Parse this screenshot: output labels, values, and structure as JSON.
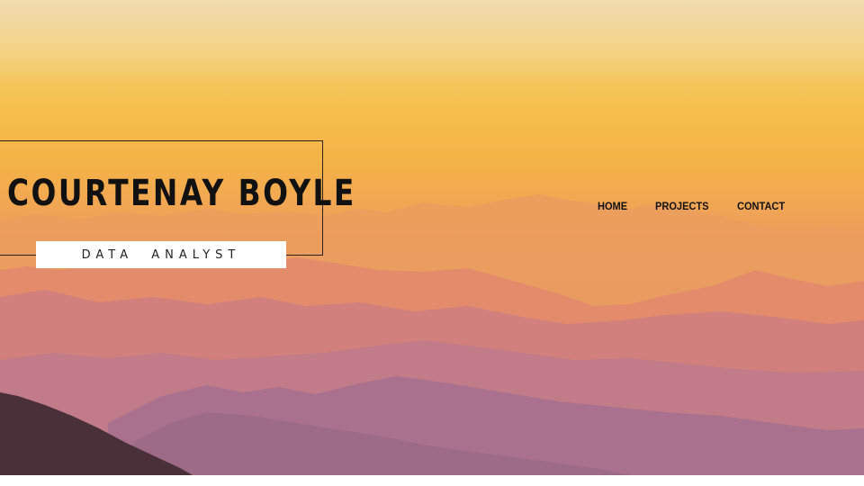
{
  "brand": {
    "name": "COURTENAY BOYLE",
    "subtitle": "DATA  ANALYST"
  },
  "nav": {
    "items": [
      {
        "label": "HOME"
      },
      {
        "label": "PROJECTS"
      },
      {
        "label": "CONTACT"
      }
    ]
  },
  "hero": {
    "background": "sunset-mountains-image"
  },
  "colors": {
    "sky_top": "#e9d2a8",
    "sky_mid": "#f6c04d",
    "ridge_far": "#e8946a",
    "ridge_mid": "#cf8480",
    "ridge_near": "#a8718c",
    "ridge_front": "#4a3038",
    "text": "#111111"
  }
}
